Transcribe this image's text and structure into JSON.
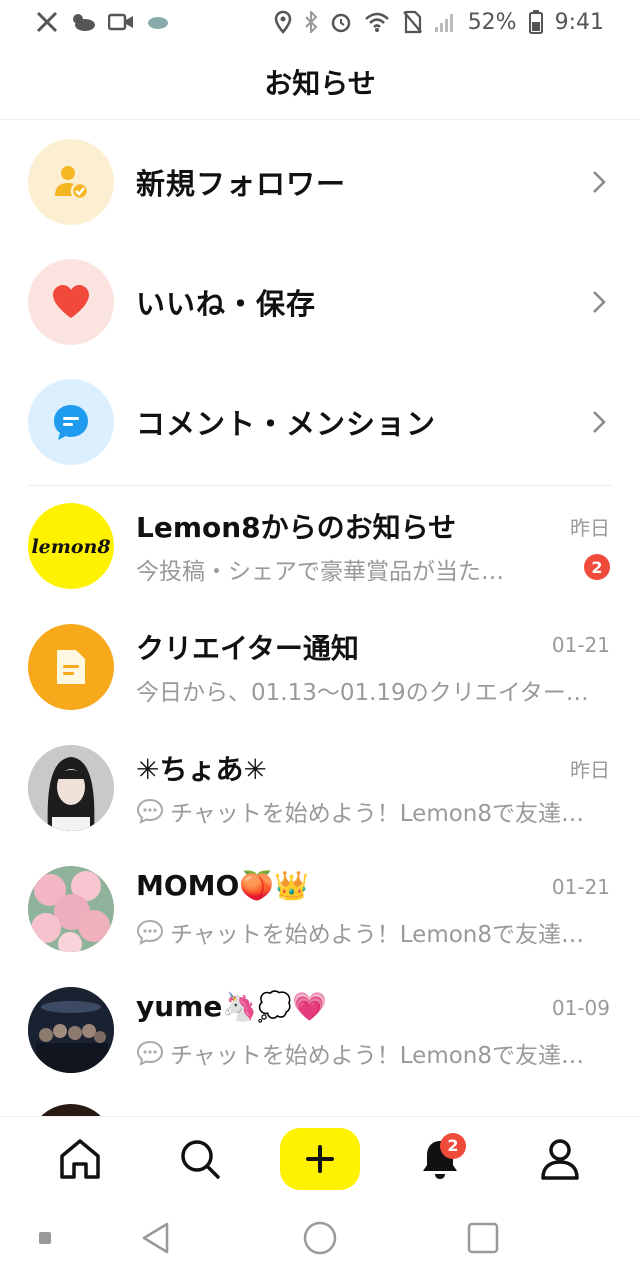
{
  "status_bar": {
    "battery": "52%",
    "time": "9:41"
  },
  "header": {
    "title": "お知らせ"
  },
  "categories": [
    {
      "label": "新規フォロワー",
      "icon": "person-check-icon",
      "color": "#fbeed1"
    },
    {
      "label": "いいね・保存",
      "icon": "heart-icon",
      "color": "#fbe3df"
    },
    {
      "label": "コメント・メンション",
      "icon": "comment-icon",
      "color": "#dcefff"
    }
  ],
  "messages": [
    {
      "name": "Lemon8からのお知らせ",
      "time": "昨日",
      "preview": "今投稿・シェアで豪華賞品が当た…",
      "unread": "2"
    },
    {
      "name": "クリエイター通知",
      "time": "01-21",
      "preview": "今日から、01.13～01.19のクリエイター…"
    },
    {
      "name": "✳︎ちょあ✳︎",
      "time": "昨日",
      "preview": "チャットを始めよう！Lemon8で友達…"
    },
    {
      "name": "MOMO🍑👑",
      "time": "01-21",
      "preview": "チャットを始めよう！Lemon8で友達…"
    },
    {
      "name": "yume🦄💭💗",
      "time": "01-09",
      "preview": "チャットを始めよう！Lemon8で友達…"
    }
  ],
  "lemon8_logo_text": "lemon8",
  "bottom_nav": {
    "notification_badge": "2"
  },
  "colors": {
    "accent_yellow": "#fff200",
    "badge_red": "#f04a3a",
    "creator_orange": "#f7a81b"
  }
}
